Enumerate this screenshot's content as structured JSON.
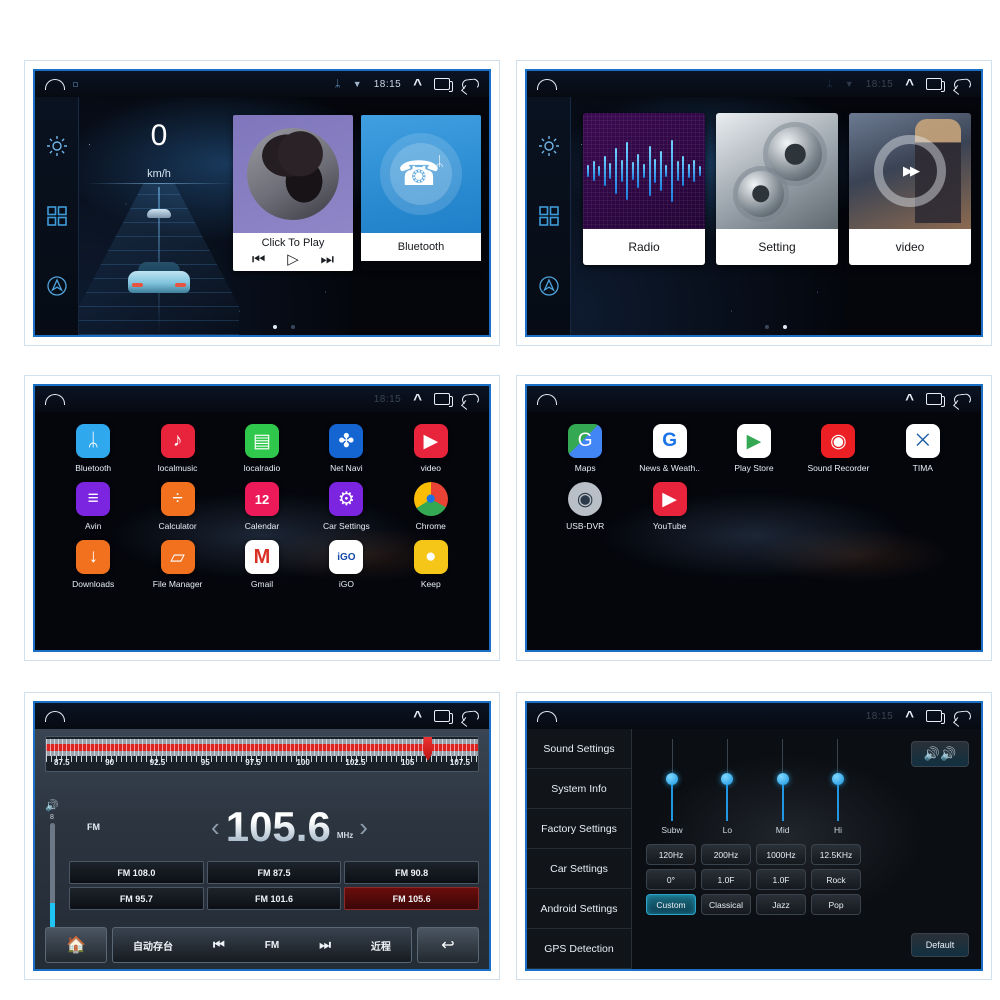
{
  "statusbar": {
    "time": "18:15",
    "bluetooth_icon": "bluetooth-icon",
    "wifi_icon": "wifi-icon",
    "up_icon": "chevron-up-icon",
    "recents_icon": "recents-icon",
    "back_icon": "back-icon",
    "home_icon": "home-icon"
  },
  "home": {
    "rail": [
      {
        "name": "settings-gear-icon",
        "label": "Settings"
      },
      {
        "name": "apps-grid-icon",
        "label": "Apps"
      },
      {
        "name": "navigation-icon",
        "label": "Navigation"
      }
    ],
    "speed": {
      "value": "0",
      "unit": "km/h"
    },
    "cards": [
      {
        "name": "music",
        "label": "Click To Play",
        "prev": "⏮",
        "play": "▷",
        "next": "⏭"
      },
      {
        "name": "bluetooth",
        "label": "Bluetooth"
      }
    ],
    "dots": [
      true,
      false
    ]
  },
  "home2": {
    "tiles": [
      {
        "name": "radio",
        "label": "Radio"
      },
      {
        "name": "setting",
        "label": "Setting"
      },
      {
        "name": "video",
        "label": "video"
      }
    ],
    "dots": [
      false,
      true
    ]
  },
  "apps_page1": {
    "items": [
      {
        "label": "Bluetooth",
        "icon": "bluetooth-icon",
        "bg": "#2fa8ee",
        "glyph": "ᛦ"
      },
      {
        "label": "localmusic",
        "icon": "music-note-icon",
        "bg": "#e8233c",
        "glyph": "♪"
      },
      {
        "label": "localradio",
        "icon": "radio-icon",
        "bg": "#2fc84c",
        "glyph": "▤"
      },
      {
        "label": "Net Navi",
        "icon": "compass-icon",
        "bg": "#1464d2",
        "glyph": "✤"
      },
      {
        "label": "video",
        "icon": "play-circle-icon",
        "bg": "#e8233c",
        "glyph": "▶"
      },
      {
        "label": "Avin",
        "icon": "equalizer-icon",
        "bg": "#7b25e0",
        "glyph": "≡"
      },
      {
        "label": "Calculator",
        "icon": "calculator-icon",
        "bg": "#f1711f",
        "glyph": "÷"
      },
      {
        "label": "Calendar",
        "icon": "calendar-icon",
        "bg": "#ec1a58",
        "glyph": "12"
      },
      {
        "label": "Car Settings",
        "icon": "gear-icon",
        "bg": "#7b25e0",
        "glyph": "⚙"
      },
      {
        "label": "Chrome",
        "icon": "chrome-icon",
        "bg": "#ffffff",
        "glyph": "●"
      },
      {
        "label": "Downloads",
        "icon": "download-icon",
        "bg": "#f1711f",
        "glyph": "↓"
      },
      {
        "label": "File Manager",
        "icon": "folder-icon",
        "bg": "#f1711f",
        "glyph": "▱"
      },
      {
        "label": "Gmail",
        "icon": "mail-icon",
        "bg": "#ffffff",
        "glyph": "M"
      },
      {
        "label": "iGO",
        "icon": "igo-icon",
        "bg": "#ffffff",
        "glyph": "iGO"
      },
      {
        "label": "Keep",
        "icon": "lightbulb-icon",
        "bg": "#f5c518",
        "glyph": "●"
      }
    ]
  },
  "apps_page2": {
    "items": [
      {
        "label": "Maps",
        "icon": "maps-icon",
        "bg": "#3fa34d",
        "glyph": "G"
      },
      {
        "label": "News & Weath..",
        "icon": "news-icon",
        "bg": "#ffffff",
        "glyph": "G"
      },
      {
        "label": "Play Store",
        "icon": "play-store-icon",
        "bg": "#ffffff",
        "glyph": "▶"
      },
      {
        "label": "Sound Recorder",
        "icon": "record-icon",
        "bg": "#ec2024",
        "glyph": "◉"
      },
      {
        "label": "TIMA",
        "icon": "tima-icon",
        "bg": "#ffffff",
        "glyph": "⨉"
      },
      {
        "label": "USB-DVR",
        "icon": "dvr-camera-icon",
        "bg": "#b9bfc6",
        "glyph": "◉"
      },
      {
        "label": "YouTube",
        "icon": "youtube-icon",
        "bg": "#e8233c",
        "glyph": "▶"
      }
    ]
  },
  "radio": {
    "band": "FM",
    "frequency": "105.6",
    "unit": "MHz",
    "prev_arrow": "‹",
    "next_arrow": "›",
    "volume": {
      "level": "8",
      "speaker_icon": "speaker-icon",
      "fill_percent": 24
    },
    "scale": {
      "ticks": [
        "87.5",
        "90",
        "92.5",
        "95",
        "97.5",
        "100",
        "102.5",
        "105",
        "107.5"
      ],
      "min": 87.5,
      "max": 108.0,
      "needle_at": 105.6
    },
    "presets": [
      {
        "label": "FM 108.0",
        "active": false
      },
      {
        "label": "FM 87.5",
        "active": false
      },
      {
        "label": "FM 90.8",
        "active": false
      },
      {
        "label": "FM 95.7",
        "active": false
      },
      {
        "label": "FM 101.6",
        "active": false
      },
      {
        "label": "FM 105.6",
        "active": true
      }
    ],
    "bottom_bar": {
      "home_icon": "home-icon",
      "auto_store": "自动存台",
      "prev_icon": "⏮",
      "band_label": "FM",
      "next_icon": "⏭",
      "local_range": "近程",
      "back_icon": "↩"
    }
  },
  "sound": {
    "sidebar": [
      "Sound Settings",
      "System Info",
      "Factory Settings",
      "Car Settings",
      "Android Settings",
      "GPS Detection"
    ],
    "sliders": [
      {
        "label": "Subw"
      },
      {
        "label": "Lo"
      },
      {
        "label": "Mid"
      },
      {
        "label": "Hi"
      }
    ],
    "eq_buttons": [
      {
        "label": "120Hz",
        "active": false
      },
      {
        "label": "200Hz",
        "active": false
      },
      {
        "label": "1000Hz",
        "active": false
      },
      {
        "label": "12.5KHz",
        "active": false
      },
      {
        "label": "0°",
        "active": false
      },
      {
        "label": "1.0F",
        "active": false
      },
      {
        "label": "1.0F",
        "active": false
      },
      {
        "label": "Rock",
        "active": false
      },
      {
        "label": "Custom",
        "active": true
      },
      {
        "label": "Classical",
        "active": false
      },
      {
        "label": "Jazz",
        "active": false
      },
      {
        "label": "Pop",
        "active": false
      }
    ],
    "speaker_button": {
      "icon": "balance-speaker-icon"
    },
    "default_button": {
      "label": "Default"
    }
  },
  "colors": {
    "frame_border": "#1b6fc4",
    "page_bg": "#ffffff",
    "accent_blue": "#2196e3",
    "radio_red": "#d22222"
  }
}
